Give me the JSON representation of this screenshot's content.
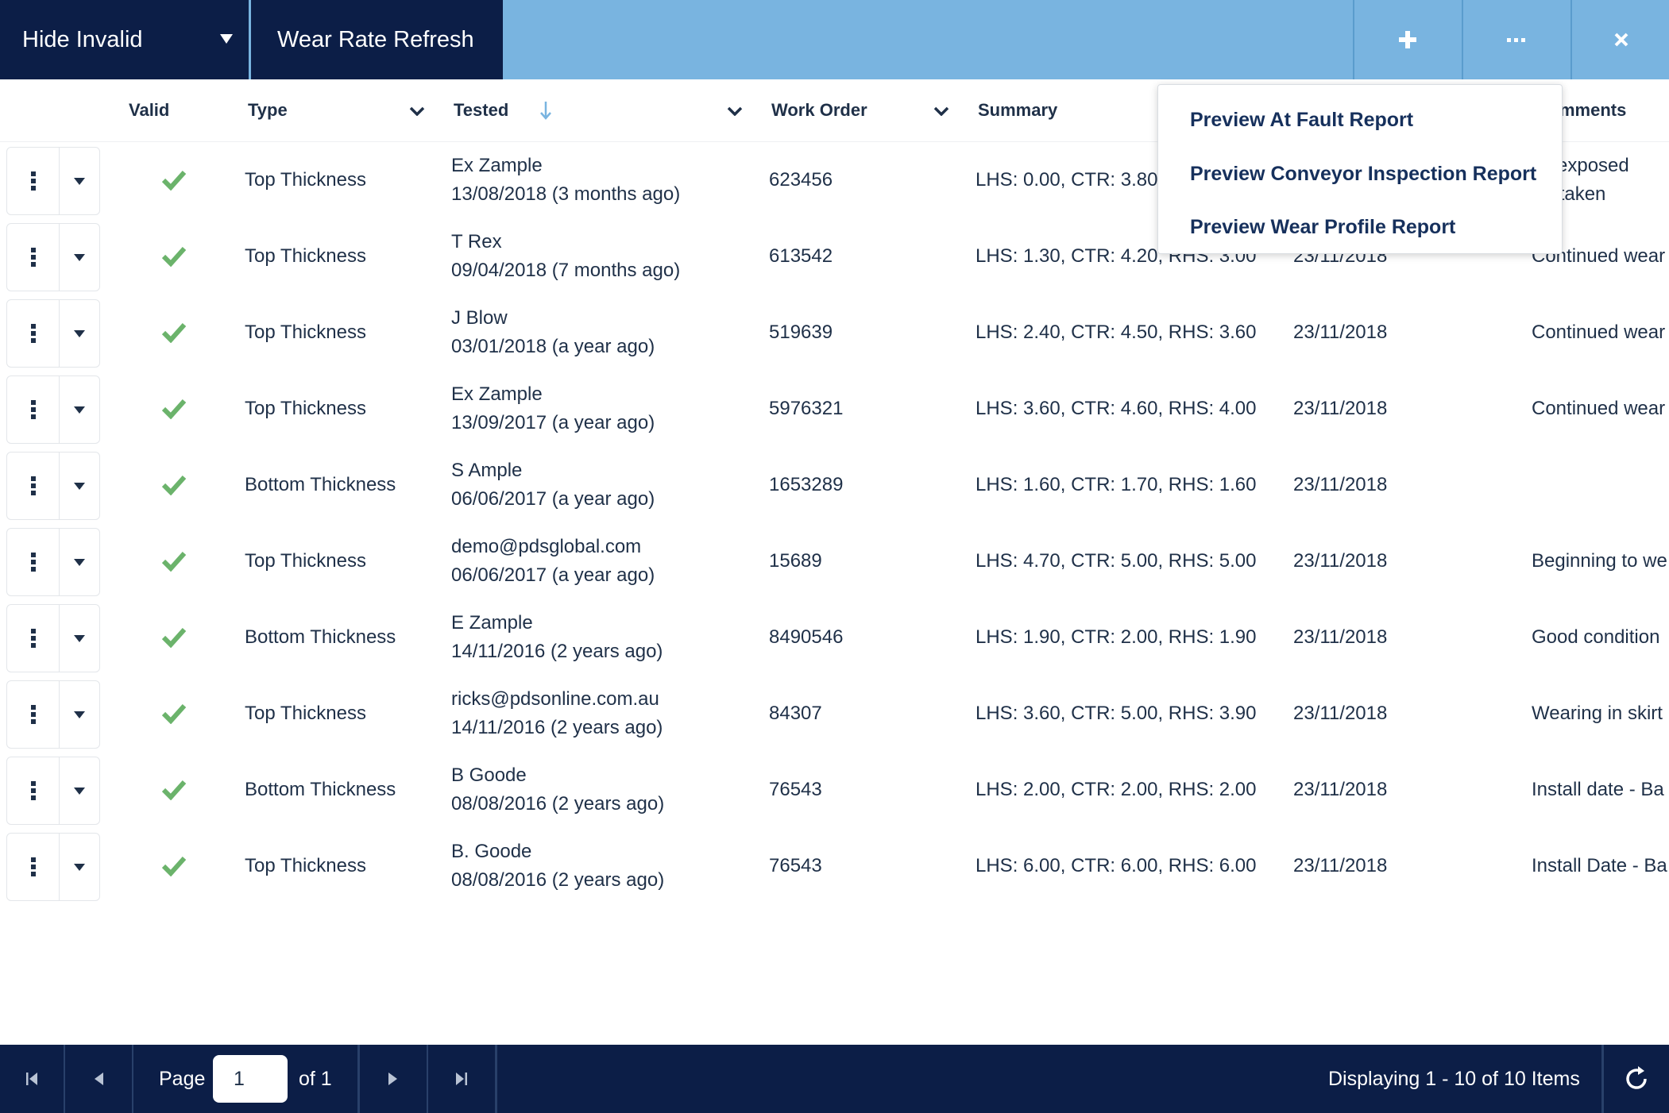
{
  "toolbar": {
    "hide_invalid_label": "Hide Invalid",
    "wear_rate_refresh_label": "Wear Rate Refresh",
    "add_icon": "plus-icon",
    "more_icon": "ellipsis-icon",
    "close_icon": "close-icon"
  },
  "columns": {
    "valid": "Valid",
    "type": "Type",
    "tested": "Tested",
    "work_order": "Work Order",
    "summary": "Summary",
    "comments": "mments"
  },
  "menu": {
    "items": [
      "Preview At Fault Report",
      "Preview Conveyor Inspection Report",
      "Preview Wear Profile Report"
    ]
  },
  "rows": [
    {
      "type": "Top Thickness",
      "tester": "Ex Zample",
      "tested_date": "13/08/2018 (3 months ago)",
      "work_order": "623456",
      "summary": "LHS: 0.00, CTR: 3.80,",
      "date": "",
      "comment": "ric exposed",
      "comment2": "dertaken"
    },
    {
      "type": "Top Thickness",
      "tester": "T Rex",
      "tested_date": "09/04/2018 (7 months ago)",
      "work_order": "613542",
      "summary": "LHS: 1.30, CTR: 4.20, RHS: 3.00",
      "date": "23/11/2018",
      "comment": "Continued wear",
      "comment2": ""
    },
    {
      "type": "Top Thickness",
      "tester": "J Blow",
      "tested_date": "03/01/2018 (a year ago)",
      "work_order": "519639",
      "summary": "LHS: 2.40, CTR: 4.50, RHS: 3.60",
      "date": "23/11/2018",
      "comment": "Continued wear",
      "comment2": ""
    },
    {
      "type": "Top Thickness",
      "tester": "Ex Zample",
      "tested_date": "13/09/2017 (a year ago)",
      "work_order": "5976321",
      "summary": "LHS: 3.60, CTR: 4.60, RHS: 4.00",
      "date": "23/11/2018",
      "comment": "Continued wear",
      "comment2": ""
    },
    {
      "type": "Bottom Thickness",
      "tester": "S Ample",
      "tested_date": "06/06/2017 (a year ago)",
      "work_order": "1653289",
      "summary": "LHS: 1.60, CTR: 1.70, RHS: 1.60",
      "date": "23/11/2018",
      "comment": "",
      "comment2": ""
    },
    {
      "type": "Top Thickness",
      "tester": "demo@pdsglobal.com",
      "tested_date": "06/06/2017 (a year ago)",
      "work_order": "15689",
      "summary": "LHS: 4.70, CTR: 5.00, RHS: 5.00",
      "date": "23/11/2018",
      "comment": "Beginning to we",
      "comment2": ""
    },
    {
      "type": "Bottom Thickness",
      "tester": "E Zample",
      "tested_date": "14/11/2016 (2 years ago)",
      "work_order": "8490546",
      "summary": "LHS: 1.90, CTR: 2.00, RHS: 1.90",
      "date": "23/11/2018",
      "comment": "Good condition",
      "comment2": ""
    },
    {
      "type": "Top Thickness",
      "tester": "ricks@pdsonline.com.au",
      "tested_date": "14/11/2016 (2 years ago)",
      "work_order": "84307",
      "summary": "LHS: 3.60, CTR: 5.00, RHS: 3.90",
      "date": "23/11/2018",
      "comment": "Wearing in skirt",
      "comment2": ""
    },
    {
      "type": "Bottom Thickness",
      "tester": "B Goode",
      "tested_date": "08/08/2016 (2 years ago)",
      "work_order": "76543",
      "summary": "LHS: 2.00, CTR: 2.00, RHS: 2.00",
      "date": "23/11/2018",
      "comment": "Install date - Ba",
      "comment2": ""
    },
    {
      "type": "Top Thickness",
      "tester": "B. Goode",
      "tested_date": "08/08/2016 (2 years ago)",
      "work_order": "76543",
      "summary": "LHS: 6.00, CTR: 6.00, RHS: 6.00",
      "date": "23/11/2018",
      "comment": "Install Date - Ba",
      "comment2": ""
    }
  ],
  "pager": {
    "page_label": "Page",
    "page_value": "1",
    "of_label": "of 1",
    "display_text": "Displaying 1 - 10 of 10 Items"
  },
  "colors": {
    "navy": "#0c1e47",
    "toolbar_blue": "#79b4e0",
    "check_green": "#6bb36b",
    "sort_arrow_blue": "#79b4e0"
  }
}
